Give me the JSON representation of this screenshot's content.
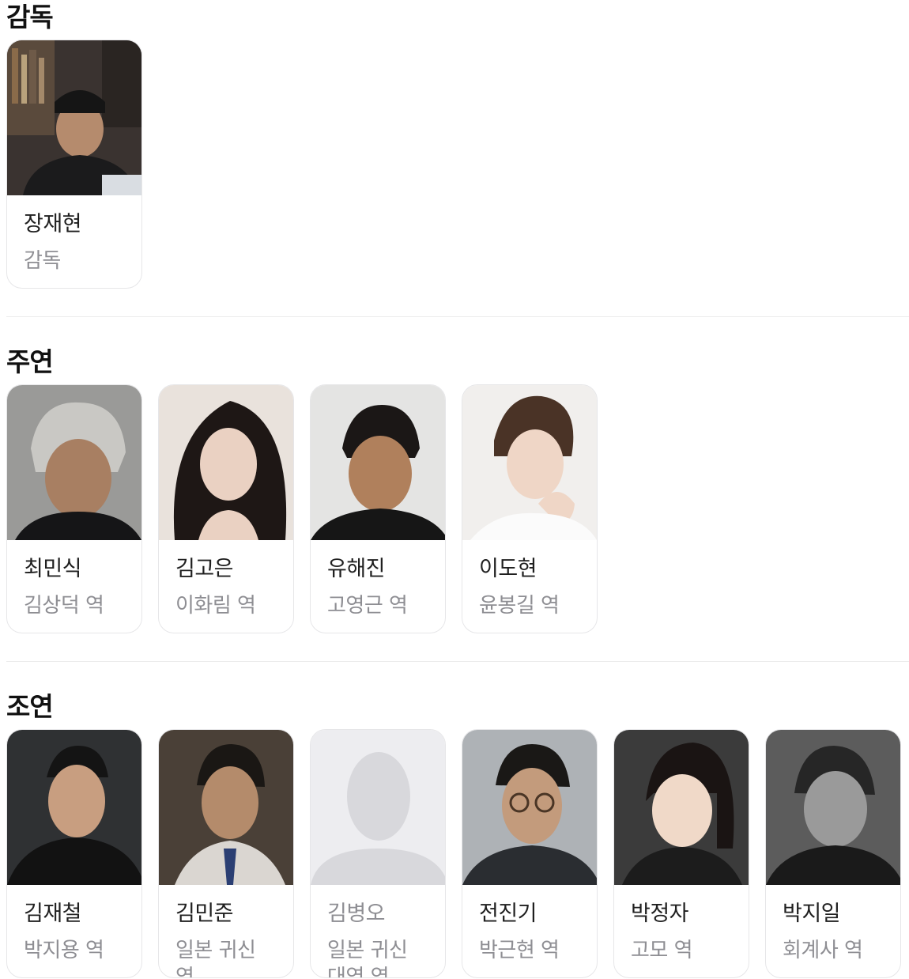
{
  "sections": [
    {
      "title": "감독",
      "people": [
        {
          "name": "장재현",
          "role": "감독",
          "photo": "director-photo"
        }
      ]
    },
    {
      "title": "주연",
      "people": [
        {
          "name": "최민식",
          "role": "김상덕 역",
          "photo": "actor-photo"
        },
        {
          "name": "김고은",
          "role": "이화림 역",
          "photo": "actor-photo"
        },
        {
          "name": "유해진",
          "role": "고영근 역",
          "photo": "actor-photo"
        },
        {
          "name": "이도현",
          "role": "윤봉길 역",
          "photo": "actor-photo"
        }
      ]
    },
    {
      "title": "조연",
      "people": [
        {
          "name": "김재철",
          "role": "박지용 역",
          "photo": "actor-photo"
        },
        {
          "name": "김민준",
          "role": "일본 귀신 역",
          "photo": "actor-photo"
        },
        {
          "name": "김병오",
          "role": "일본 귀신 대역 역",
          "photo": "person-placeholder-icon"
        },
        {
          "name": "전진기",
          "role": "박근현 역",
          "photo": "actor-photo"
        },
        {
          "name": "박정자",
          "role": "고모 역",
          "photo": "actor-photo"
        },
        {
          "name": "박지일",
          "role": "회계사 역",
          "photo": "actor-photo"
        }
      ]
    }
  ],
  "colors": {
    "card_border": "#e6e6e8",
    "name_text": "#1f1f1f",
    "role_text": "#8e8e93",
    "placeholder_bg": "#ededf0",
    "placeholder_figure": "#d8d8dc"
  }
}
